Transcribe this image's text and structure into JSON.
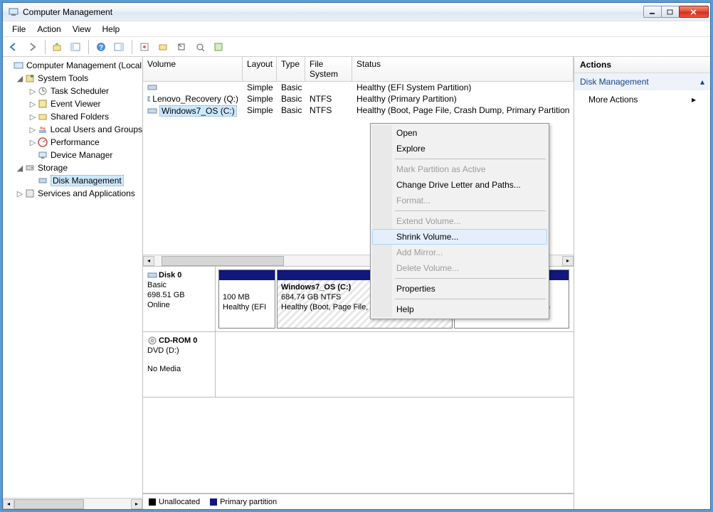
{
  "window": {
    "title": "Computer Management"
  },
  "menubar": [
    "File",
    "Action",
    "View",
    "Help"
  ],
  "tree": {
    "root": "Computer Management (Local",
    "systools": "System Tools",
    "items_sys": [
      "Task Scheduler",
      "Event Viewer",
      "Shared Folders",
      "Local Users and Groups",
      "Performance",
      "Device Manager"
    ],
    "storage": "Storage",
    "disk_mgmt": "Disk Management",
    "services": "Services and Applications"
  },
  "columns": {
    "volume": "Volume",
    "layout": "Layout",
    "type": "Type",
    "fs": "File System",
    "status": "Status"
  },
  "col_w": {
    "volume": 140,
    "layout": 48,
    "type": 40,
    "fs": 66,
    "status": 300
  },
  "volumes": [
    {
      "name": "",
      "layout": "Simple",
      "type": "Basic",
      "fs": "",
      "status": "Healthy (EFI System Partition)",
      "selected": false
    },
    {
      "name": "Lenovo_Recovery (Q:)",
      "layout": "Simple",
      "type": "Basic",
      "fs": "NTFS",
      "status": "Healthy (Primary Partition)",
      "selected": false
    },
    {
      "name": "Windows7_OS (C:)",
      "layout": "Simple",
      "type": "Basic",
      "fs": "NTFS",
      "status": "Healthy (Boot, Page File, Crash Dump, Primary Partition",
      "selected": true
    }
  ],
  "disk0": {
    "name": "Disk 0",
    "type": "Basic",
    "size": "698.51 GB",
    "state": "Online",
    "p1": {
      "size": "100 MB",
      "status": "Healthy (EFI"
    },
    "p2": {
      "name": "Windows7_OS  (C:)",
      "size": "684.74 GB NTFS",
      "status": "Healthy (Boot, Page File, Crash Dump, Prir"
    },
    "p3": {
      "status": "Healthy (Primary Partition)"
    }
  },
  "cdrom": {
    "name": "CD-ROM 0",
    "type": "DVD (D:)",
    "state": "No Media"
  },
  "legend": {
    "unalloc": "Unallocated",
    "primary": "Primary partition"
  },
  "actions": {
    "header": "Actions",
    "section": "Disk Management",
    "more": "More Actions"
  },
  "context": {
    "open": "Open",
    "explore": "Explore",
    "mark": "Mark Partition as Active",
    "change": "Change Drive Letter and Paths...",
    "format": "Format...",
    "extend": "Extend Volume...",
    "shrink": "Shrink Volume...",
    "mirror": "Add Mirror...",
    "delete": "Delete Volume...",
    "props": "Properties",
    "help": "Help"
  }
}
